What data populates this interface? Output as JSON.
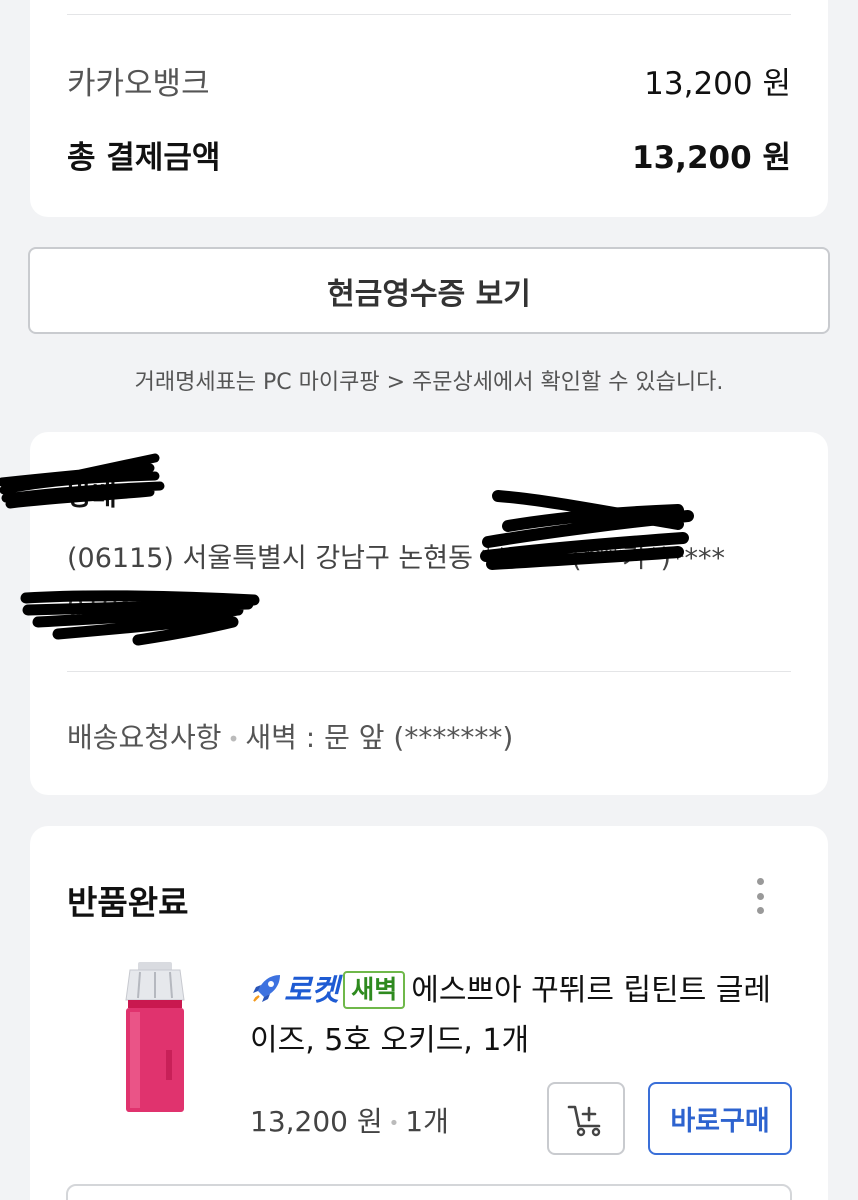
{
  "payment": {
    "method_label": "카카오뱅크",
    "method_amount": "13,200 원",
    "total_label": "총 결제금액",
    "total_amount": "13,200 원"
  },
  "receipt_button": "현금영수증 보기",
  "notice": "거래명세표는 PC 마이쿠팡 > 주문상세에서 확인할 수 있습니다.",
  "address": {
    "name": "방배",
    "line": "(06115) 서울특별시 강남구 논현동 *** ***(***가*)****",
    "phone": "010****3076",
    "request_label": "배송요청사항",
    "request_value": "새벽 : 문 앞 (*******)"
  },
  "order": {
    "status": "반품완료",
    "rocket_label": "로켓",
    "dawn_badge": "새벽",
    "product_name": "에스쁘아 꾸뛰르 립틴트 글레이즈, 5호 오키드, 1개",
    "price": "13,200 원",
    "quantity": "1개",
    "buy_button": "바로구매"
  },
  "colors": {
    "accent_blue": "#2d63cf",
    "dawn_green": "#2e8a1f",
    "product_pink": "#e0336e"
  },
  "icons": [
    "rocket-icon",
    "cart-add-icon",
    "more-vertical-icon"
  ]
}
